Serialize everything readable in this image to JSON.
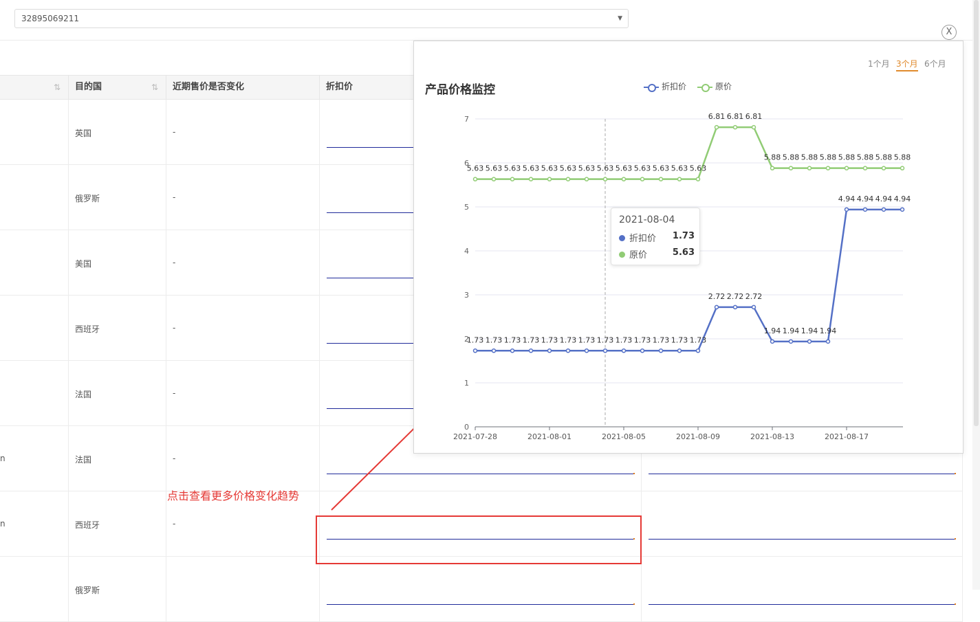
{
  "top": {
    "select_value": "32895069211",
    "close_label": "X"
  },
  "table": {
    "headers": [
      {
        "label": ""
      },
      {
        "label": "目的国"
      },
      {
        "label": "近期售价是否变化"
      },
      {
        "label": "折扣价"
      }
    ],
    "rows": [
      {
        "col0": "",
        "country": "英国",
        "changed": "-"
      },
      {
        "col0": "",
        "country": "俄罗斯",
        "changed": "-"
      },
      {
        "col0": "",
        "country": "美国",
        "changed": "-"
      },
      {
        "col0": "",
        "country": "西班牙",
        "changed": "-"
      },
      {
        "col0": "",
        "country": "法国",
        "changed": "-"
      },
      {
        "col0": "n",
        "country": "法国",
        "changed": "-"
      },
      {
        "col0": "n",
        "country": "西班牙",
        "changed": "-"
      },
      {
        "col0": "",
        "country": "俄罗斯",
        "changed": ""
      }
    ]
  },
  "annotation": {
    "text": "点击查看更多价格变化趋势"
  },
  "popup": {
    "title": "产品价格监控",
    "periods": [
      "1个月",
      "3个月",
      "6个月"
    ],
    "active_period": "3个月",
    "legend": [
      "折扣价",
      "原价"
    ],
    "colors": {
      "discount": "#5470c6",
      "original": "#91cc75",
      "accent": "#e08a2c",
      "annotation": "#e53935"
    },
    "tooltip": {
      "date": "2021-08-04",
      "items": [
        {
          "name": "折扣价",
          "value": "1.73"
        },
        {
          "name": "原价",
          "value": "5.63"
        }
      ]
    }
  },
  "chart_data": {
    "type": "line",
    "title": "产品价格监控",
    "x": [
      "2021-07-28",
      "2021-07-29",
      "2021-07-30",
      "2021-07-31",
      "2021-08-01",
      "2021-08-02",
      "2021-08-03",
      "2021-08-04",
      "2021-08-05",
      "2021-08-06",
      "2021-08-07",
      "2021-08-08",
      "2021-08-09",
      "2021-08-10",
      "2021-08-11",
      "2021-08-12",
      "2021-08-13",
      "2021-08-14",
      "2021-08-15",
      "2021-08-16",
      "2021-08-17",
      "2021-08-18",
      "2021-08-19",
      "2021-08-20"
    ],
    "x_tick_labels": [
      "2021-07-28",
      "2021-08-01",
      "2021-08-05",
      "2021-08-09",
      "2021-08-13",
      "2021-08-17"
    ],
    "y_ticks": [
      0,
      1,
      2,
      3,
      4,
      5,
      6,
      7
    ],
    "ylim": [
      0,
      7
    ],
    "grid": true,
    "legend_position": "top-center",
    "series": [
      {
        "name": "折扣价",
        "values": [
          1.73,
          1.73,
          1.73,
          1.73,
          1.73,
          1.73,
          1.73,
          1.73,
          1.73,
          1.73,
          1.73,
          1.73,
          1.73,
          2.72,
          2.72,
          2.72,
          1.94,
          1.94,
          1.94,
          1.94,
          4.94,
          4.94,
          4.94,
          4.94
        ]
      },
      {
        "name": "原价",
        "values": [
          5.63,
          5.63,
          5.63,
          5.63,
          5.63,
          5.63,
          5.63,
          5.63,
          5.63,
          5.63,
          5.63,
          5.63,
          5.63,
          6.81,
          6.81,
          6.81,
          5.88,
          5.88,
          5.88,
          5.88,
          5.88,
          5.88,
          5.88,
          5.88
        ]
      }
    ]
  }
}
